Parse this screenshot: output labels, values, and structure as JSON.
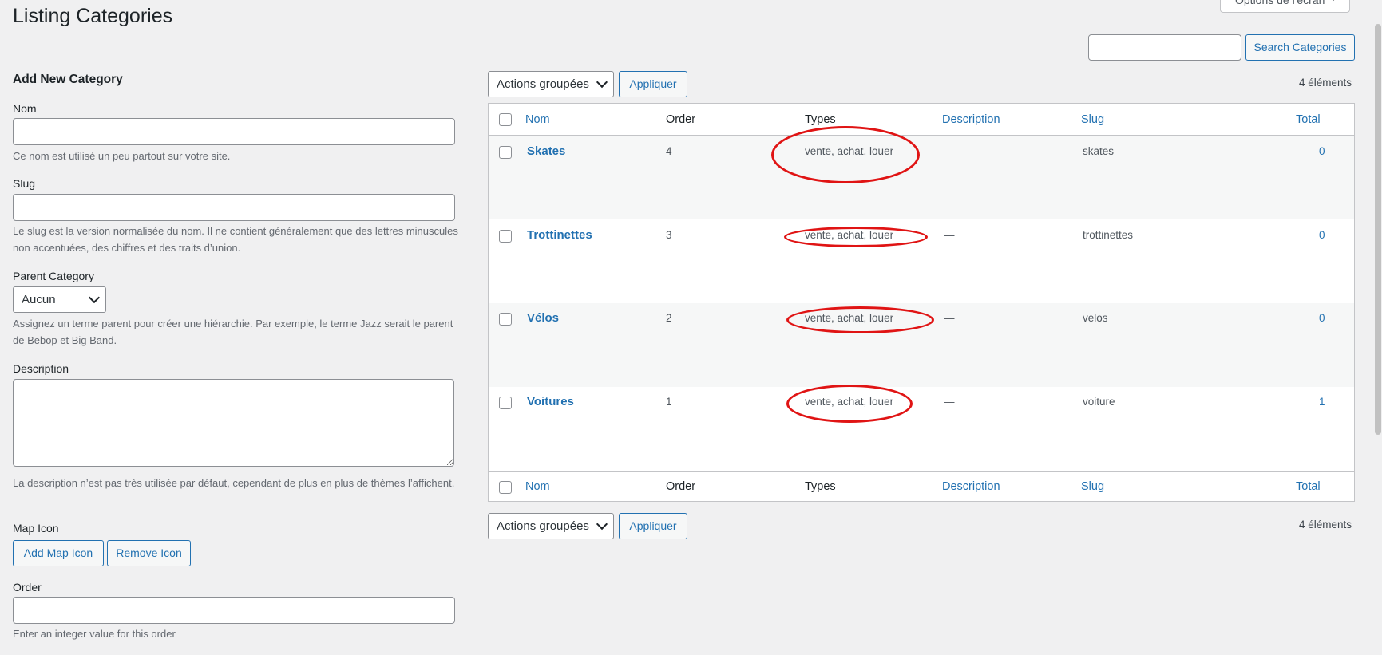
{
  "page": {
    "title": "Listing Categories",
    "screen_options_label": "Options de l'écran"
  },
  "search": {
    "placeholder": "",
    "button_label": "Search Categories"
  },
  "form": {
    "heading": "Add New Category",
    "name_label": "Nom",
    "name_hint": "Ce nom est utilisé un peu partout sur votre site.",
    "slug_label": "Slug",
    "slug_hint": "Le slug est la version normalisée du nom. Il ne contient généralement que des lettres minuscules non accentuées, des chiffres et des traits d’union.",
    "parent_label": "Parent Category",
    "parent_value": "Aucun",
    "parent_hint": "Assignez un terme parent pour créer une hiérarchie. Par exemple, le terme Jazz serait le parent de Bebop et Big Band.",
    "description_label": "Description",
    "description_hint": "La description n’est pas très utilisée par défaut, cependant de plus en plus de thèmes l’affichent.",
    "map_icon_label": "Map Icon",
    "add_map_icon_label": "Add Map Icon",
    "remove_icon_label": "Remove Icon",
    "order_label": "Order",
    "order_hint": "Enter an integer value for this order"
  },
  "bulk": {
    "actions_label": "Actions groupées",
    "apply_label": "Appliquer",
    "count_label": "4 éléments"
  },
  "table": {
    "headers": {
      "name": "Nom",
      "order": "Order",
      "types": "Types",
      "description": "Description",
      "slug": "Slug",
      "total": "Total"
    },
    "rows": [
      {
        "name": "Skates",
        "order": "4",
        "types": "vente, achat, louer",
        "description": "—",
        "slug": "skates",
        "total": "0"
      },
      {
        "name": "Trottinettes",
        "order": "3",
        "types": "vente, achat, louer",
        "description": "—",
        "slug": "trottinettes",
        "total": "0"
      },
      {
        "name": "Vélos",
        "order": "2",
        "types": "vente, achat, louer",
        "description": "—",
        "slug": "velos",
        "total": "0"
      },
      {
        "name": "Voitures",
        "order": "1",
        "types": "vente, achat, louer",
        "description": "—",
        "slug": "voiture",
        "total": "1"
      }
    ]
  },
  "annotation": {
    "color": "#e01414"
  }
}
